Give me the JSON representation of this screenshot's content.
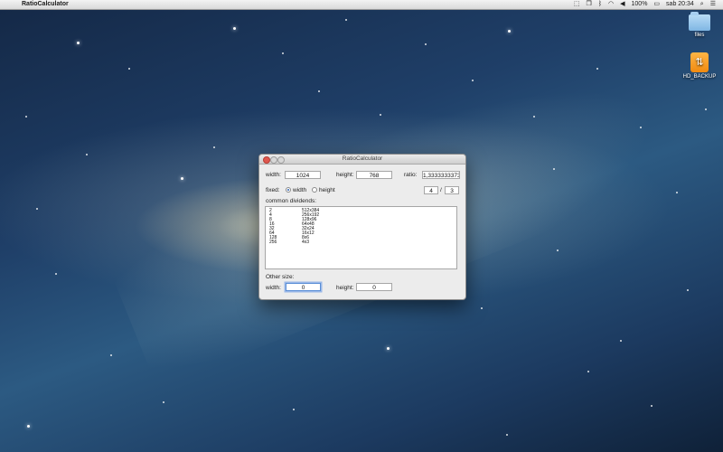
{
  "menubar": {
    "app_name": "RatioCalculator",
    "battery": "100%",
    "clock": "sab 20:34"
  },
  "desktop": {
    "icons": [
      {
        "label": "files",
        "icon": "folder-icon"
      },
      {
        "label": "HD_BACKUP",
        "icon": "usb-drive-icon"
      }
    ]
  },
  "window": {
    "title": "RatioCalculator",
    "width_label": "width:",
    "width_value": "1024",
    "height_label": "height:",
    "height_value": "768",
    "ratio_label": "ratio:",
    "ratio_value": "1,33333333733",
    "fixed_label": "fixed:",
    "fixed_options": [
      "width",
      "height"
    ],
    "fixed_selected": "width",
    "ratio_num": "4",
    "ratio_sep": "/",
    "ratio_den": "3",
    "dividends_label": "common dividends:",
    "dividends": [
      {
        "divisor": "2",
        "size": "512x384"
      },
      {
        "divisor": "4",
        "size": "256x192"
      },
      {
        "divisor": "8",
        "size": "128x96"
      },
      {
        "divisor": "16",
        "size": "64x48"
      },
      {
        "divisor": "32",
        "size": "32x24"
      },
      {
        "divisor": "64",
        "size": "16x12"
      },
      {
        "divisor": "128",
        "size": "8x6"
      },
      {
        "divisor": "256",
        "size": "4x3"
      }
    ],
    "other_size_label": "Other size:",
    "other_width_label": "width:",
    "other_width_value": "0",
    "other_height_label": "height:",
    "other_height_value": "0"
  }
}
